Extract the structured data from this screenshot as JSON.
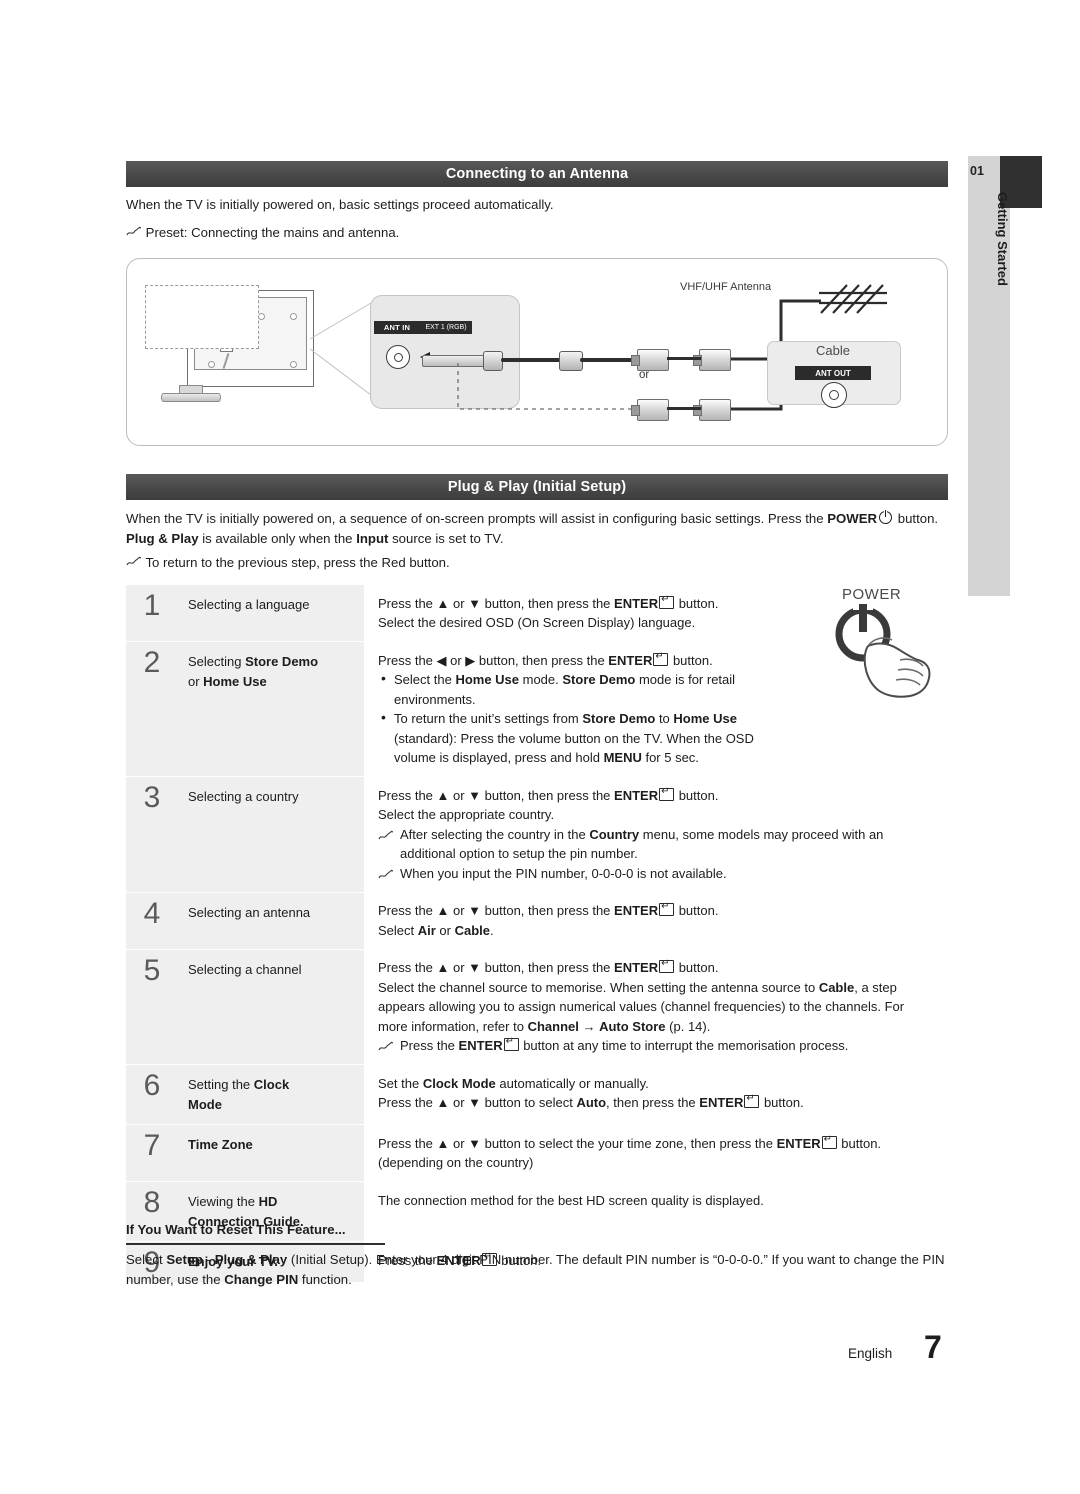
{
  "sections": {
    "antenna": {
      "title": "Connecting to an Antenna",
      "line1": "When the TV is initially powered on, basic settings proceed automatically.",
      "note1": "Preset: Connecting the mains and antenna."
    },
    "plugplay": {
      "title": "Plug & Play (Initial Setup)",
      "intro_a": "When the TV is initially powered on, a sequence of on-screen prompts will assist in configuring basic settings. Press the ",
      "intro_power": "POWER",
      "intro_b": " button. ",
      "intro_pp": "Plug & Play",
      "intro_c": " is available only when the ",
      "intro_input": "Input",
      "intro_d": " source is set to TV.",
      "note_return": "To return to the previous step, press the Red button."
    }
  },
  "diagram": {
    "ant_in_label": "ANT IN",
    "ext_label": "EXT 1 (RGB)",
    "vhf_label": "VHF/UHF Antenna",
    "or_label": "or",
    "cable_label": "Cable",
    "ant_out_label": "ANT OUT"
  },
  "steps": [
    {
      "num": "1",
      "label_parts": [
        {
          "t": "Selecting a language",
          "b": false
        }
      ],
      "lines": [
        {
          "type": "plain",
          "parts": [
            {
              "t": "Press the ▲ or ▼ button, then press the ",
              "b": false
            },
            {
              "t": "ENTER",
              "b": true
            },
            {
              "t": "enterkey",
              "b": false
            },
            {
              "t": " button.",
              "b": false
            }
          ]
        },
        {
          "type": "plain",
          "parts": [
            {
              "t": "Select the desired OSD (On Screen Display) language.",
              "b": false
            }
          ]
        }
      ]
    },
    {
      "num": "2",
      "label_parts": [
        {
          "t": "Selecting ",
          "b": false
        },
        {
          "t": "Store Demo",
          "b": true
        },
        {
          "t": "\n",
          "b": false
        },
        {
          "t": "or ",
          "b": false
        },
        {
          "t": "Home Use",
          "b": true
        }
      ],
      "lines": [
        {
          "type": "plain",
          "parts": [
            {
              "t": "Press the ◀ or ▶ button, then press the ",
              "b": false
            },
            {
              "t": "ENTER",
              "b": true
            },
            {
              "t": "enterkey",
              "b": false
            },
            {
              "t": " button.",
              "b": false
            }
          ]
        },
        {
          "type": "bullet",
          "parts": [
            {
              "t": "Select the ",
              "b": false
            },
            {
              "t": "Home Use",
              "b": true
            },
            {
              "t": " mode. ",
              "b": false
            },
            {
              "t": "Store Demo",
              "b": true
            },
            {
              "t": " mode is for retail",
              "b": false
            }
          ]
        },
        {
          "type": "plain_indent",
          "parts": [
            {
              "t": "environments.",
              "b": false
            }
          ]
        },
        {
          "type": "bullet",
          "parts": [
            {
              "t": "To return the unit’s settings from ",
              "b": false
            },
            {
              "t": "Store Demo",
              "b": true
            },
            {
              "t": " to ",
              "b": false
            },
            {
              "t": "Home Use",
              "b": true
            }
          ]
        },
        {
          "type": "plain_indent",
          "parts": [
            {
              "t": "(standard): Press the volume button on the TV. When the OSD",
              "b": false
            }
          ]
        },
        {
          "type": "plain_indent",
          "parts": [
            {
              "t": "volume is displayed, press and hold ",
              "b": false
            },
            {
              "t": "MENU",
              "b": true
            },
            {
              "t": " for 5 sec.",
              "b": false
            }
          ]
        }
      ]
    },
    {
      "num": "3",
      "label_parts": [
        {
          "t": "Selecting a country",
          "b": false
        }
      ],
      "lines": [
        {
          "type": "plain",
          "parts": [
            {
              "t": "Press the ▲ or ▼ button, then press the ",
              "b": false
            },
            {
              "t": "ENTER",
              "b": true
            },
            {
              "t": "enterkey",
              "b": false
            },
            {
              "t": " button.",
              "b": false
            }
          ]
        },
        {
          "type": "plain",
          "parts": [
            {
              "t": "Select the appropriate country.",
              "b": false
            }
          ]
        },
        {
          "type": "note",
          "parts": [
            {
              "t": "After selecting the country in the ",
              "b": false
            },
            {
              "t": "Country",
              "b": true
            },
            {
              "t": " menu, some models may proceed with an",
              "b": false
            }
          ]
        },
        {
          "type": "plain_note_indent",
          "parts": [
            {
              "t": "additional option to setup the pin number.",
              "b": false
            }
          ]
        },
        {
          "type": "note",
          "parts": [
            {
              "t": "When you input the PIN number, 0-0-0-0 is not available.",
              "b": false
            }
          ]
        }
      ]
    },
    {
      "num": "4",
      "label_parts": [
        {
          "t": "Selecting an antenna",
          "b": false
        }
      ],
      "lines": [
        {
          "type": "plain",
          "parts": [
            {
              "t": "Press the ▲ or ▼ button, then press the ",
              "b": false
            },
            {
              "t": "ENTER",
              "b": true
            },
            {
              "t": "enterkey",
              "b": false
            },
            {
              "t": " button.",
              "b": false
            }
          ]
        },
        {
          "type": "plain",
          "parts": [
            {
              "t": "Select ",
              "b": false
            },
            {
              "t": "Air",
              "b": true
            },
            {
              "t": " or ",
              "b": false
            },
            {
              "t": "Cable",
              "b": true
            },
            {
              "t": ".",
              "b": false
            }
          ]
        }
      ]
    },
    {
      "num": "5",
      "label_parts": [
        {
          "t": "Selecting a channel",
          "b": false
        }
      ],
      "lines": [
        {
          "type": "plain",
          "parts": [
            {
              "t": "Press the ▲ or ▼ button, then press the ",
              "b": false
            },
            {
              "t": "ENTER",
              "b": true
            },
            {
              "t": "enterkey",
              "b": false
            },
            {
              "t": " button.",
              "b": false
            }
          ]
        },
        {
          "type": "plain",
          "parts": [
            {
              "t": "Select the channel source to memorise. When setting the antenna source to ",
              "b": false
            },
            {
              "t": "Cable",
              "b": true
            },
            {
              "t": ", a step",
              "b": false
            }
          ]
        },
        {
          "type": "plain",
          "parts": [
            {
              "t": "appears allowing you to assign numerical values (channel frequencies) to the channels. For",
              "b": false
            }
          ]
        },
        {
          "type": "plain",
          "parts": [
            {
              "t": "more information, refer to ",
              "b": false
            },
            {
              "t": "Channel",
              "b": true
            },
            {
              "t": " → ",
              "b": false
            },
            {
              "t": "Auto Store",
              "b": true
            },
            {
              "t": " (p. 14).",
              "b": false
            }
          ]
        },
        {
          "type": "note",
          "parts": [
            {
              "t": "Press the ",
              "b": false
            },
            {
              "t": "ENTER",
              "b": true
            },
            {
              "t": "enterkey",
              "b": false
            },
            {
              "t": " button at any time to interrupt the memorisation process.",
              "b": false
            }
          ]
        }
      ]
    },
    {
      "num": "6",
      "label_parts": [
        {
          "t": "Setting the ",
          "b": false
        },
        {
          "t": "Clock",
          "b": true
        },
        {
          "t": "\n",
          "b": false
        },
        {
          "t": "Mode",
          "b": true
        }
      ],
      "lines": [
        {
          "type": "plain",
          "parts": [
            {
              "t": "Set the ",
              "b": false
            },
            {
              "t": "Clock Mode",
              "b": true
            },
            {
              "t": " automatically or manually.",
              "b": false
            }
          ]
        },
        {
          "type": "plain",
          "parts": [
            {
              "t": "Press the ▲ or ▼ button to select ",
              "b": false
            },
            {
              "t": "Auto",
              "b": true
            },
            {
              "t": ", then press the ",
              "b": false
            },
            {
              "t": "ENTER",
              "b": true
            },
            {
              "t": "enterkey",
              "b": false
            },
            {
              "t": " button.",
              "b": false
            }
          ]
        }
      ]
    },
    {
      "num": "7",
      "label_parts": [
        {
          "t": "Time Zone",
          "b": true
        }
      ],
      "lines": [
        {
          "type": "plain",
          "parts": [
            {
              "t": "Press the ▲ or ▼ button to select the your time zone, then press the ",
              "b": false
            },
            {
              "t": "ENTER",
              "b": true
            },
            {
              "t": "enterkey",
              "b": false
            },
            {
              "t": " button.",
              "b": false
            }
          ]
        },
        {
          "type": "plain",
          "parts": [
            {
              "t": "(depending on the country)",
              "b": false
            }
          ]
        }
      ]
    },
    {
      "num": "8",
      "label_parts": [
        {
          "t": "Viewing the ",
          "b": false
        },
        {
          "t": "HD",
          "b": true
        },
        {
          "t": "\n",
          "b": false
        },
        {
          "t": "Connection Guide.",
          "b": true
        }
      ],
      "lines": [
        {
          "type": "plain",
          "parts": [
            {
              "t": "The connection method for the best HD screen quality is displayed.",
              "b": false
            }
          ]
        }
      ]
    },
    {
      "num": "9",
      "label_parts": [
        {
          "t": "Enjoy your TV.",
          "b": true
        }
      ],
      "lines": [
        {
          "type": "plain",
          "parts": [
            {
              "t": "Press the ",
              "b": false
            },
            {
              "t": "ENTER",
              "b": true
            },
            {
              "t": "enterkey",
              "b": false
            },
            {
              "t": " button.",
              "b": false
            }
          ]
        }
      ]
    }
  ],
  "power_graphic": {
    "label": "POWER"
  },
  "reset": {
    "heading": "If You Want to Reset This Feature...",
    "line1_a": "Select ",
    "line1_setup": "Setup",
    "line1_b": " - ",
    "line1_pp": "Plug & Play",
    "line1_c": " (Initial Setup). Enter your 4 digit PIN number. The default PIN number is “0-0-0-0.” If you want to",
    "line2_a": "change the PIN number, use the ",
    "line2_changepin": "Change PIN",
    "line2_b": " function."
  },
  "side_tab": {
    "number": "01",
    "text": "Getting Started"
  },
  "footer": {
    "language": "English",
    "page": "7"
  }
}
